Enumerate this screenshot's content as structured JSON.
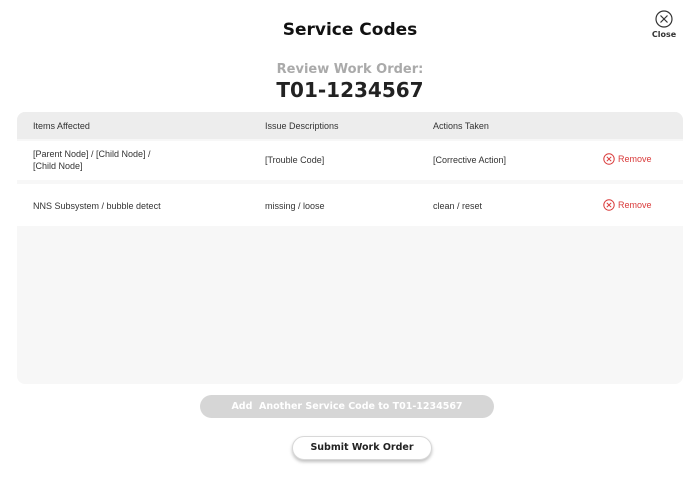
{
  "header": {
    "title": "Service Codes",
    "close_label": "Close"
  },
  "review": {
    "label": "Review Work Order:",
    "order_id": "T01-1234567"
  },
  "table": {
    "columns": [
      "Items Affected",
      "Issue Descriptions",
      "Actions Taken"
    ],
    "rows": [
      {
        "item_line1": "[Parent Node] / [Child Node] /",
        "item_line2": "[Child Node]",
        "issue": "[Trouble Code]",
        "action": "[Corrective Action]",
        "remove_label": "Remove"
      },
      {
        "item_line1": "NNS Subsystem / bubble detect",
        "item_line2": "",
        "issue": "missing / loose",
        "action": "clean / reset",
        "remove_label": "Remove"
      }
    ]
  },
  "actions": {
    "add_label": "Add  Another Service Code to T01-1234567",
    "submit_label": "Submit Work Order"
  },
  "colors": {
    "remove": "#d93a3a",
    "add_button_bg": "#d6d6d6",
    "table_bg": "#f7f7f7",
    "header_bg": "#ededed"
  },
  "icons": {
    "close": "close-circle-icon",
    "remove": "remove-circle-icon"
  }
}
